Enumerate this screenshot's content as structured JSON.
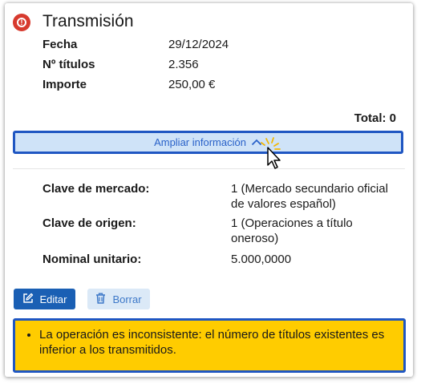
{
  "header": {
    "title": "Transmisión",
    "status_icon": "error-alert-icon"
  },
  "summary": [
    {
      "label": "Fecha",
      "value": "29/12/2024"
    },
    {
      "label": "Nº títulos",
      "value": "2.356"
    },
    {
      "label": "Importe",
      "value": "250,00 €"
    }
  ],
  "total_label": "Total: 0",
  "expand": {
    "label": "Ampliar información",
    "icon": "chevron-up-icon"
  },
  "details": [
    {
      "label": "Clave de mercado:",
      "value": "1 (Mercado secundario oficial de valores español)"
    },
    {
      "label": "Clave de origen:",
      "value": "1 (Operaciones a título oneroso)"
    },
    {
      "label": "Nominal unitario:",
      "value": "5.000,0000"
    }
  ],
  "actions": {
    "edit_label": "Editar",
    "delete_label": "Borrar"
  },
  "warning": {
    "message": "La operación es inconsistente: el número de títulos existentes es inferior a los transmitidos."
  },
  "colors": {
    "primary": "#1a5fb4",
    "highlight_border": "#1f56c2",
    "expand_bg": "#cfe3f8",
    "warning_bg": "#ffcc00",
    "error": "#d73a2e"
  }
}
